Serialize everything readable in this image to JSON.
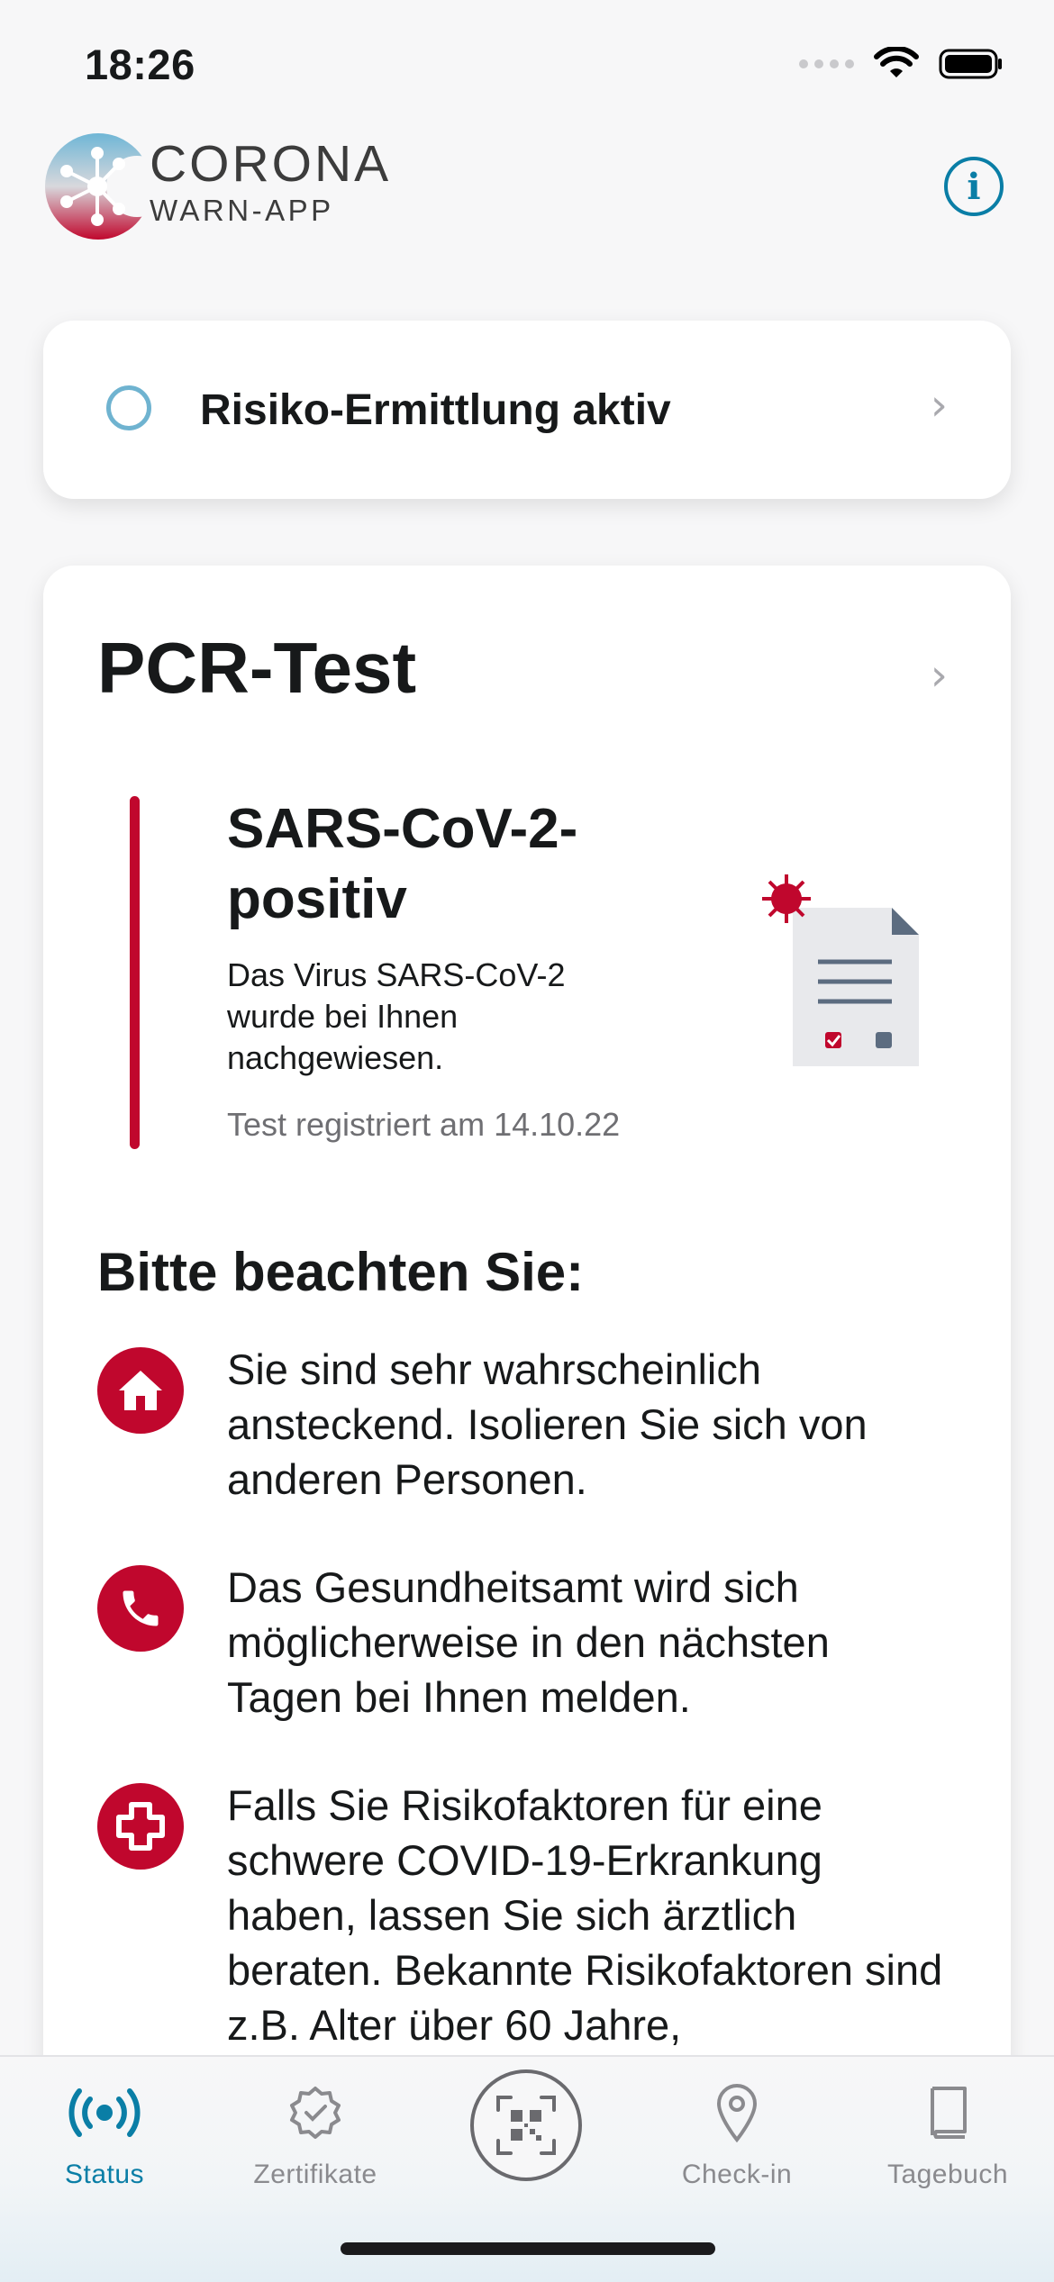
{
  "status_bar": {
    "time": "18:26"
  },
  "header": {
    "brand_line1": "CORONA",
    "brand_line2": "WARN-APP"
  },
  "risk_card": {
    "label": "Risiko-Ermittlung aktiv"
  },
  "pcr_card": {
    "title": "PCR-Test",
    "result_title": "SARS-CoV-2-positiv",
    "result_description": "Das Virus SARS-CoV-2 wurde bei Ihnen nachgewiesen.",
    "registered": "Test registriert am 14.10.22",
    "attention_heading": "Bitte beachten Sie:",
    "advice": [
      {
        "icon": "home-icon",
        "text": "Sie sind sehr wahrscheinlich ansteckend. Isolieren Sie sich von anderen Personen."
      },
      {
        "icon": "phone-icon",
        "text": "Das Gesundheitsamt wird sich möglicherweise in den nächsten Tagen bei Ihnen melden."
      },
      {
        "icon": "medical-cross-icon",
        "text": "Falls Sie Risikofaktoren für eine schwere COVID-19-Erkrankung haben, lassen Sie sich ärztlich beraten. Bekannte Risikofaktoren sind z.B. Alter über 60 Jahre,"
      }
    ]
  },
  "tab_bar": {
    "active": "Status",
    "tabs": [
      {
        "label": "Status",
        "icon": "broadcast-icon"
      },
      {
        "label": "Zertifikate",
        "icon": "certificate-badge-icon"
      },
      {
        "label": "",
        "icon": "qr-scan-icon"
      },
      {
        "label": "Check-in",
        "icon": "location-pin-icon"
      },
      {
        "label": "Tagebuch",
        "icon": "diary-book-icon"
      }
    ]
  },
  "colors": {
    "accent": "#0a7ea6",
    "positive_red": "#c0072d",
    "risk_ring": "#6fb3d0"
  }
}
